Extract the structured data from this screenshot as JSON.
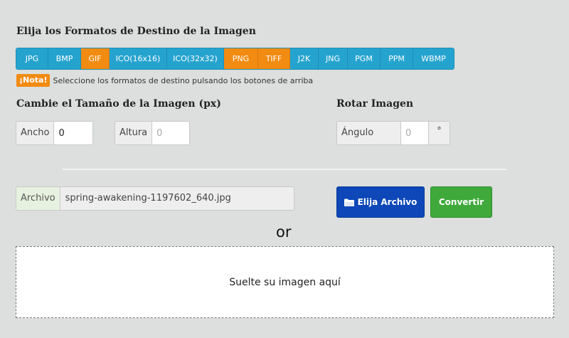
{
  "formats_section": {
    "title": "Elija los Formatos de Destino de la Imagen",
    "buttons": [
      {
        "label": "JPG",
        "active": false
      },
      {
        "label": "BMP",
        "active": false
      },
      {
        "label": "GIF",
        "active": true
      },
      {
        "label": "ICO(16x16)",
        "active": false
      },
      {
        "label": "ICO(32x32)",
        "active": false
      },
      {
        "label": "PNG",
        "active": true
      },
      {
        "label": "TIFF",
        "active": true
      },
      {
        "label": "J2K",
        "active": false
      },
      {
        "label": "JNG",
        "active": false
      },
      {
        "label": "PGM",
        "active": false
      },
      {
        "label": "PPM",
        "active": false
      },
      {
        "label": "WBMP",
        "active": false
      }
    ],
    "note_badge": "¡Nota!",
    "note_text": "Seleccione los formatos de destino pulsando los botones de arriba"
  },
  "resize": {
    "title": "Cambie el Tamaño de la Imagen (px)",
    "width_label": "Ancho",
    "width_value": "0",
    "height_label": "Altura",
    "height_placeholder": "0"
  },
  "rotate": {
    "title": "Rotar Imagen",
    "angle_label": "Ángulo (+/-)",
    "angle_placeholder": "0",
    "unit": "°"
  },
  "file": {
    "label": "Archivo",
    "filename": "spring-awakening-1197602_640.jpg",
    "choose_label": "Elija Archivo",
    "convert_label": "Convertir"
  },
  "or_text": "or",
  "dropzone_text": "Suelte su imagen aquí",
  "colors": {
    "primary": "#25a3cf",
    "active": "#f28b12",
    "choose_button": "#0d47b8",
    "convert_button": "#3fa93c"
  }
}
